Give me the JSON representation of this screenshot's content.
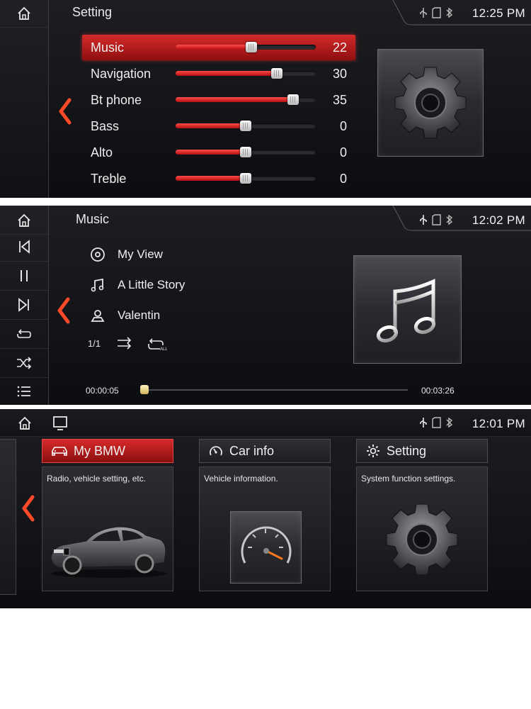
{
  "settings_screen": {
    "title": "Setting",
    "clock": "12:25 PM",
    "rows": [
      {
        "label": "Music",
        "value": "22",
        "level": 0.54,
        "active": true
      },
      {
        "label": "Navigation",
        "value": "30",
        "level": 0.72,
        "active": false
      },
      {
        "label": "Bt phone",
        "value": "35",
        "level": 0.84,
        "active": false
      },
      {
        "label": "Bass",
        "value": "0",
        "level": 0.5,
        "active": false
      },
      {
        "label": "Alto",
        "value": "0",
        "level": 0.5,
        "active": false
      },
      {
        "label": "Treble",
        "value": "0",
        "level": 0.5,
        "active": false
      }
    ],
    "tile_icon": "gear-icon"
  },
  "music_screen": {
    "title": "Music",
    "clock": "12:02 PM",
    "album": "My View",
    "track": "A Little Story",
    "artist": "Valentin",
    "track_index": "1/1",
    "elapsed": "00:00:05",
    "duration": "00:03:26",
    "progress": 0.005,
    "side_icons": [
      "home-icon",
      "previous-track-icon",
      "pause-icon",
      "next-track-icon",
      "repeat-icon",
      "shuffle-icon",
      "playlist-icon"
    ],
    "tile_icon": "music-note-icon"
  },
  "home_screen": {
    "clock": "12:01 PM",
    "cards": [
      {
        "title": "My BMW",
        "desc": "Radio, vehicle setting, etc.",
        "active": true
      },
      {
        "title": "Car info",
        "desc": "Vehicle information.",
        "active": false
      },
      {
        "title": "Setting",
        "desc": "System function settings.",
        "active": false
      }
    ]
  },
  "colors": {
    "accent_red": "#c81e1e",
    "background": "#121317"
  }
}
